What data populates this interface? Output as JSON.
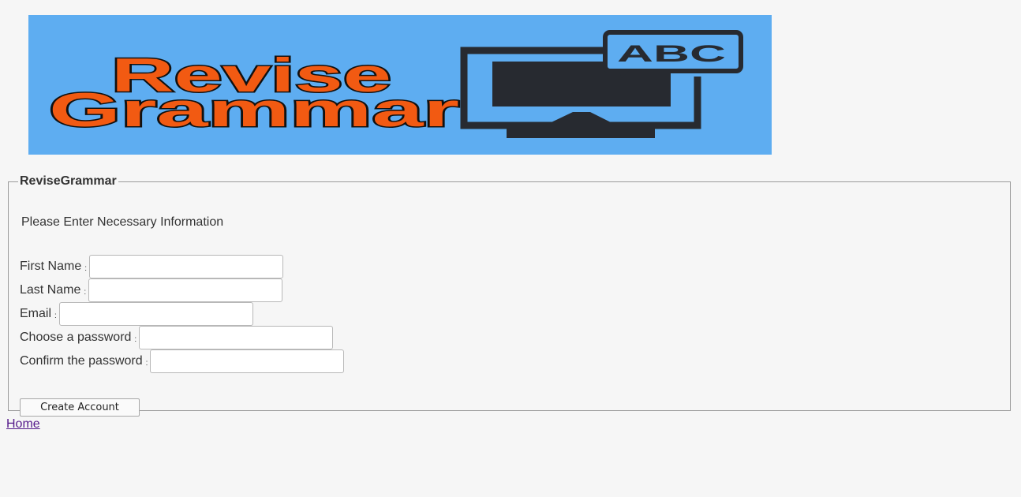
{
  "banner": {
    "logo_line1": "Revise",
    "logo_line2": "Grammar",
    "bubble_text": "ABC",
    "background_color": "#5eadf1",
    "logo_text_color": "#f25a12",
    "icon_color": "#272a30",
    "icon": "monitor-speech-bubble-icon"
  },
  "form": {
    "legend": "ReviseGrammar",
    "intro": "Please Enter Necessary Information",
    "colon": ":",
    "fields": [
      {
        "label": "First Name",
        "value": ""
      },
      {
        "label": "Last Name",
        "value": ""
      },
      {
        "label": "Email",
        "value": ""
      },
      {
        "label": "Choose a password",
        "value": ""
      },
      {
        "label": "Confirm the password",
        "value": ""
      }
    ],
    "submit_label": "Create Account"
  },
  "footer": {
    "home_link": "Home",
    "link_color": "#551a8b"
  }
}
